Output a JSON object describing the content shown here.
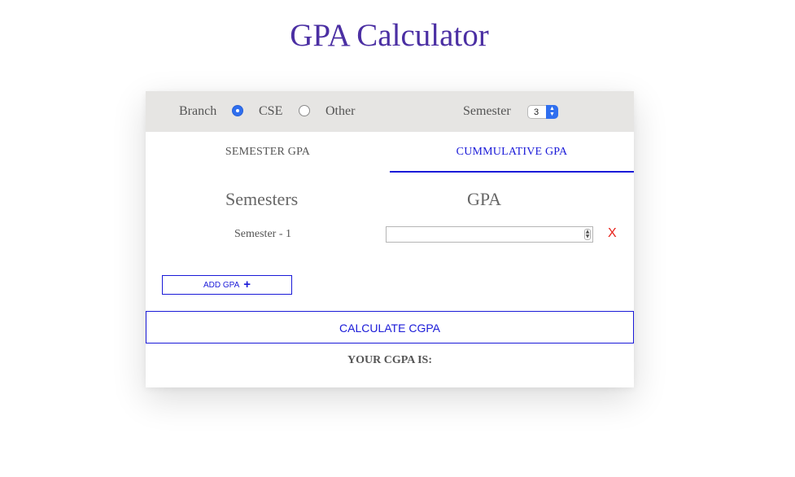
{
  "page": {
    "title": "GPA Calculator"
  },
  "topbar": {
    "branch_label": "Branch",
    "branch_options": [
      {
        "label": "CSE",
        "checked": true
      },
      {
        "label": "Other",
        "checked": false
      }
    ],
    "semester_label": "Semester",
    "semester_value": "3"
  },
  "tabs": [
    {
      "label": "SEMESTER GPA",
      "active": false
    },
    {
      "label": "CUMMULATIVE GPA",
      "active": true
    }
  ],
  "table": {
    "col_semesters": "Semesters",
    "col_gpa": "GPA",
    "rows": [
      {
        "label": "Semester - 1",
        "gpa_value": "",
        "remove_label": "X"
      }
    ]
  },
  "actions": {
    "add_gpa_label": "ADD GPA",
    "add_gpa_icon": "+",
    "calculate_label": "CALCULATE CGPA"
  },
  "result": {
    "label": "YOUR CGPA IS:"
  },
  "colors": {
    "title": "#4b2fa3",
    "accent": "#1a1ad8",
    "danger": "#e8221b",
    "topbar_bg": "#e6e5e3"
  },
  "icons": {
    "select_arrows": "chevron-up-down-icon",
    "spinner": "number-spinner-icon",
    "plus": "plus-icon",
    "remove": "close-x-icon"
  }
}
